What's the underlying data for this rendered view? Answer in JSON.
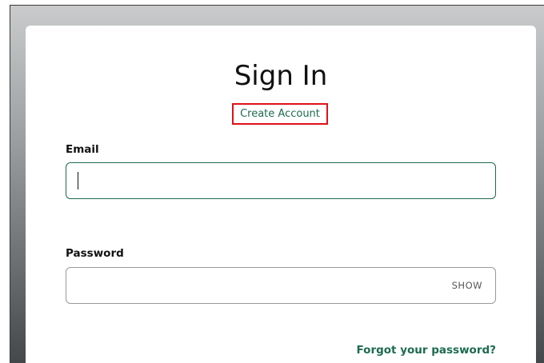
{
  "signin": {
    "title": "Sign In",
    "create_account_link": "Create Account",
    "email_label": "Email",
    "email_value": "",
    "password_label": "Password",
    "password_value": "",
    "show_toggle_label": "SHOW",
    "forgot_password_link": "Forgot your password?"
  },
  "colors": {
    "accent": "#1c6b4f",
    "highlight_box": "#e0101a",
    "input_border": "#9a9a9a"
  }
}
